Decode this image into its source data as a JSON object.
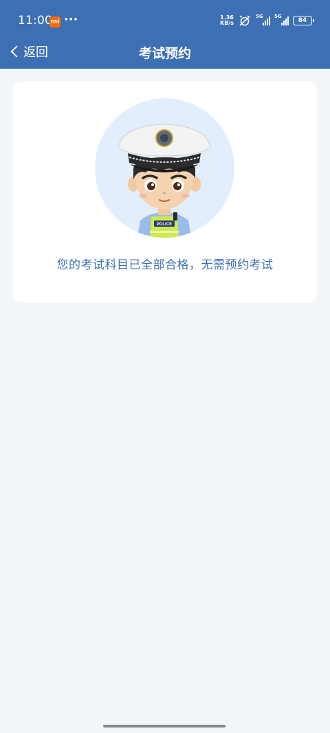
{
  "status_bar": {
    "time": "11:00",
    "app_badge": "mi",
    "dots": "···",
    "net_speed_value": "1.36",
    "net_speed_unit": "KB/s",
    "signal_1_tag": "5G",
    "signal_2_tag": "5G",
    "battery": "84"
  },
  "nav": {
    "back_label": "返回",
    "title": "考试预约"
  },
  "card": {
    "badge_text": "POLICE",
    "message": "您的考试科目已全部合格，无需预约考试"
  },
  "colors": {
    "header_bg": "#3d6fb5",
    "page_bg": "#f3f6f9",
    "accent_text": "#3d6fb5",
    "avatar_bg": "#e3eefc"
  },
  "icons": {
    "back": "chevron-left-icon",
    "mute": "alarm-off-icon",
    "signal": "signal-icon",
    "battery": "battery-icon",
    "avatar": "police-officer-avatar-icon"
  }
}
